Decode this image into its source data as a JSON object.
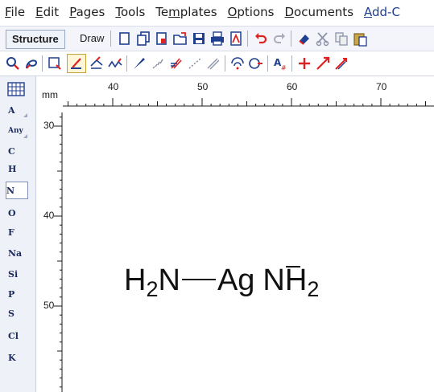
{
  "menu": [
    {
      "label": "File"
    },
    {
      "label": "Edit"
    },
    {
      "label": "Pages"
    },
    {
      "label": "Tools"
    },
    {
      "label": "Templates"
    },
    {
      "label": "Options"
    },
    {
      "label": "Documents"
    },
    {
      "label": "Add-C"
    }
  ],
  "toolbar": {
    "structure_label": "Structure",
    "draw_label": "Draw"
  },
  "ruler": {
    "unit": "mm",
    "h_labels": [
      "40",
      "50",
      "60",
      "70"
    ],
    "v_labels": [
      "30",
      "40",
      "50"
    ]
  },
  "elements": [
    "A",
    "Any",
    "C",
    "H",
    "N",
    "O",
    "F",
    "Na",
    "Si",
    "P",
    "S",
    "Cl",
    "K"
  ],
  "selected_element": "N",
  "molecule": {
    "left": "H",
    "left_sub": "2",
    "left_atom": "N",
    "center": "Ag",
    "right": "NH",
    "right_sub": "2"
  },
  "colors": {
    "toolbar_bg": "#f3f5fa",
    "panel_bg": "#eef1f8",
    "accent_blue": "#1b2a5c",
    "bond_red": "#cc1111"
  }
}
